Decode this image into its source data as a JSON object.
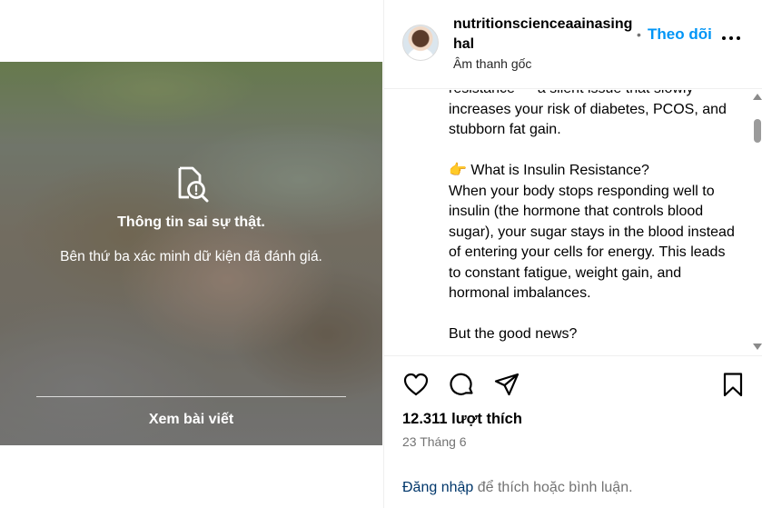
{
  "post": {
    "fact_check": {
      "title": "Thông tin sai sự thật.",
      "subtitle": "Bên thứ ba xác minh dữ kiện đã đánh giá.",
      "view_post_label": "Xem bài viết",
      "icon": "fact-check-icon"
    }
  },
  "header": {
    "username": "nutritionscienceaainasinghal",
    "audio": "Âm thanh gốc",
    "separator": "•",
    "follow_label": "Theo dõi",
    "more_icon": "more-options-icon"
  },
  "caption": {
    "lines": [
      "resistance — a silent issue that slowly increases your risk of diabetes, PCOS, and stubborn fat gain.",
      "",
      "👉 What is Insulin Resistance?",
      "When your body stops responding well to insulin (the hormone that controls blood sugar), your sugar stays in the blood instead of entering your cells for energy. This leads to constant fatigue, weight gain, and hormonal imbalances.",
      "",
      "But the good news?"
    ]
  },
  "actions": {
    "icons": [
      "heart-icon",
      "comment-icon",
      "share-icon",
      "bookmark-icon"
    ],
    "likes_text": "12.311 lượt thích",
    "date_text": "23 Tháng 6",
    "login_link": "Đăng nhập",
    "login_rest": " để thích hoặc bình luận."
  },
  "colors": {
    "follow_blue": "#0095f6",
    "link_dark_blue": "#00376b",
    "muted_gray": "#737373"
  }
}
